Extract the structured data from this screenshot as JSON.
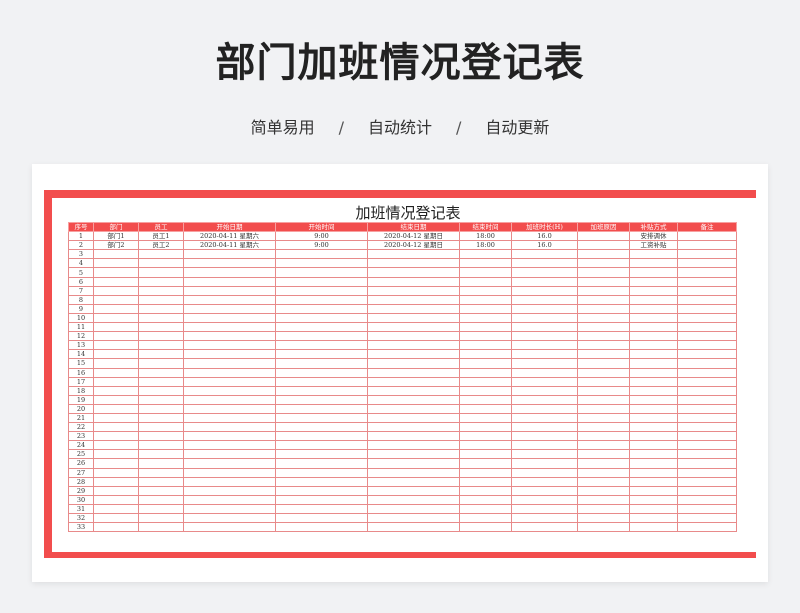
{
  "header": {
    "title": "部门加班情况登记表",
    "features": [
      "简单易用",
      "自动统计",
      "自动更新"
    ],
    "separator": "/"
  },
  "sheet": {
    "title": "加班情况登记表",
    "columns": [
      "序号",
      "部门",
      "员工",
      "开始日期",
      "开始时间",
      "结束日期",
      "结束时间",
      "加班时长(H)",
      "加班原因",
      "补贴方式",
      "备注"
    ],
    "rows": [
      [
        "1",
        "部门1",
        "员工1",
        "2020-04-11  星期六",
        "9:00",
        "2020-04-12  星期日",
        "18:00",
        "16.0",
        "",
        "安排调休",
        ""
      ],
      [
        "2",
        "部门2",
        "员工2",
        "2020-04-11  星期六",
        "9:00",
        "2020-04-12  星期日",
        "18:00",
        "16.0",
        "",
        "工资补贴",
        ""
      ],
      [
        "3"
      ],
      [
        "4"
      ],
      [
        "5"
      ],
      [
        "6"
      ],
      [
        "7"
      ],
      [
        "8"
      ],
      [
        "9"
      ],
      [
        "10"
      ],
      [
        "11"
      ],
      [
        "12"
      ],
      [
        "13"
      ],
      [
        "14"
      ],
      [
        "15"
      ],
      [
        "16"
      ],
      [
        "17"
      ],
      [
        "18"
      ],
      [
        "19"
      ],
      [
        "20"
      ],
      [
        "21"
      ],
      [
        "22"
      ],
      [
        "23"
      ],
      [
        "24"
      ],
      [
        "25"
      ],
      [
        "26"
      ],
      [
        "27"
      ],
      [
        "28"
      ],
      [
        "29"
      ],
      [
        "30"
      ],
      [
        "31"
      ],
      [
        "32"
      ],
      [
        "33"
      ]
    ]
  },
  "colors": {
    "accent": "#f24d4d",
    "grid": "#e88a8a",
    "background": "#f1f2f4"
  }
}
